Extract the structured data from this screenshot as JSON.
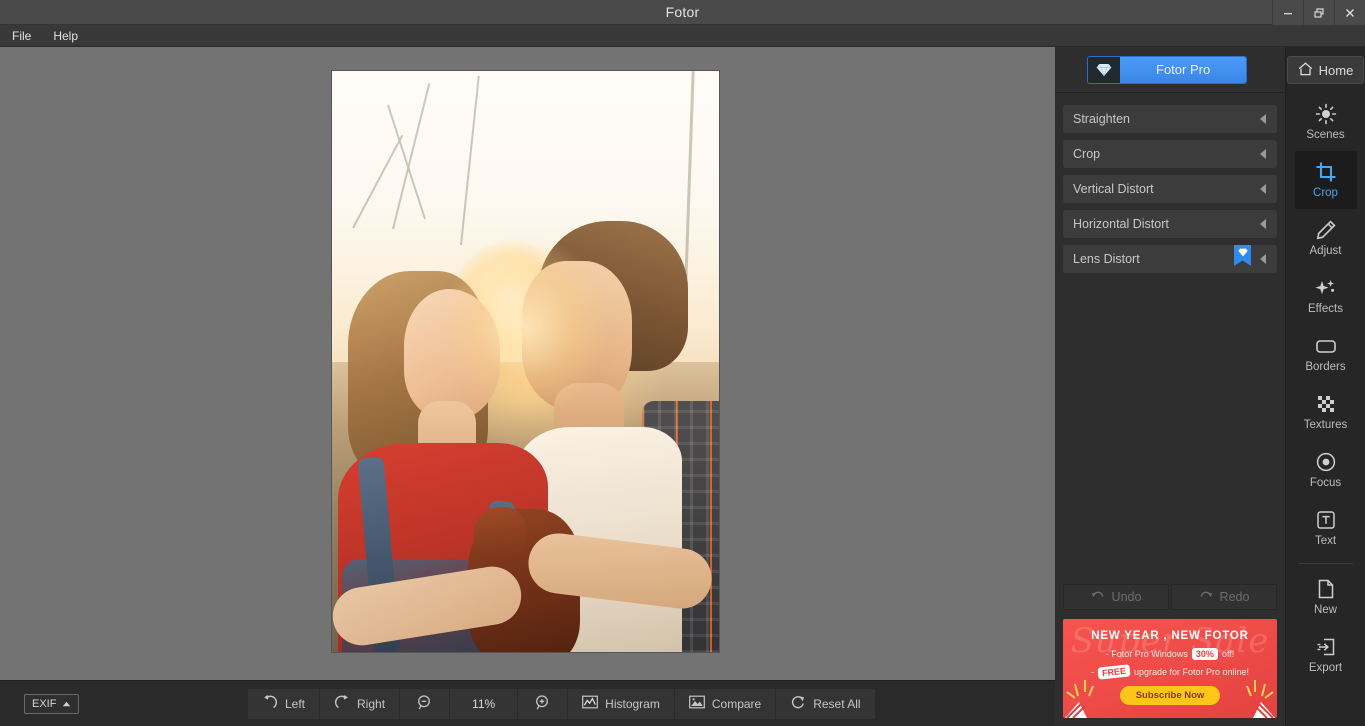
{
  "window": {
    "title": "Fotor",
    "minimize_label": "Minimize",
    "restore_label": "Restore",
    "close_label": "Close"
  },
  "menubar": {
    "items": [
      {
        "label": "File"
      },
      {
        "label": "Help"
      }
    ]
  },
  "panel": {
    "pro_button": {
      "label": "Fotor Pro",
      "icon": "diamond-icon",
      "accent": "#3a85e8"
    },
    "rows": [
      {
        "label": "Straighten",
        "pro": false
      },
      {
        "label": "Crop",
        "pro": false
      },
      {
        "label": "Vertical Distort",
        "pro": false
      },
      {
        "label": "Horizontal Distort",
        "pro": false
      },
      {
        "label": "Lens Distort",
        "pro": true
      }
    ],
    "history": {
      "undo_label": "Undo",
      "redo_label": "Redo"
    }
  },
  "promo": {
    "script": "Super Sale",
    "headline": "NEW YEAR , NEW FOTOR",
    "line1_prefix": "- Fotor Pro Windows",
    "line1_chip": "30%",
    "line1_suffix": "off!",
    "line2_prefix": "-",
    "line2_chip": "FREE",
    "line2_suffix": "upgrade for Fotor Pro online!",
    "cta": "Subscribe Now",
    "bg_color": "#ee4a47",
    "cta_color": "#ffc61a"
  },
  "tools": {
    "home": {
      "label": "Home",
      "icon": "home-icon"
    },
    "items": [
      {
        "label": "Scenes",
        "icon": "sun-icon",
        "active": false
      },
      {
        "label": "Crop",
        "icon": "crop-icon",
        "active": true
      },
      {
        "label": "Adjust",
        "icon": "pencil-icon",
        "active": false
      },
      {
        "label": "Effects",
        "icon": "sparkle-icon",
        "active": false
      },
      {
        "label": "Borders",
        "icon": "rounded-rect-icon",
        "active": false
      },
      {
        "label": "Textures",
        "icon": "checker-icon",
        "active": false
      },
      {
        "label": "Focus",
        "icon": "target-icon",
        "active": false
      },
      {
        "label": "Text",
        "icon": "text-box-icon",
        "active": false
      }
    ],
    "file_items": [
      {
        "label": "New",
        "icon": "page-icon"
      },
      {
        "label": "Export",
        "icon": "export-icon"
      }
    ],
    "active_accent": "#49a6f5"
  },
  "bottombar": {
    "exif": {
      "label": "EXIF",
      "icon": "caret-up-icon"
    },
    "buttons": [
      {
        "label": "Left",
        "icon": "rotate-left-icon"
      },
      {
        "label": "Right",
        "icon": "rotate-right-icon"
      },
      {
        "label": "",
        "icon": "zoom-out-icon"
      },
      {
        "label": "11%",
        "icon": "zoom-level"
      },
      {
        "label": "",
        "icon": "zoom-in-icon"
      },
      {
        "label": "Histogram",
        "icon": "histogram-icon"
      },
      {
        "label": "Compare",
        "icon": "compare-icon"
      },
      {
        "label": "Reset  All",
        "icon": "reset-icon"
      }
    ],
    "zoom_level": "11%"
  },
  "canvas": {
    "photo_alt": "Couple at sunset holding a chicken",
    "background_color": "#737373"
  }
}
